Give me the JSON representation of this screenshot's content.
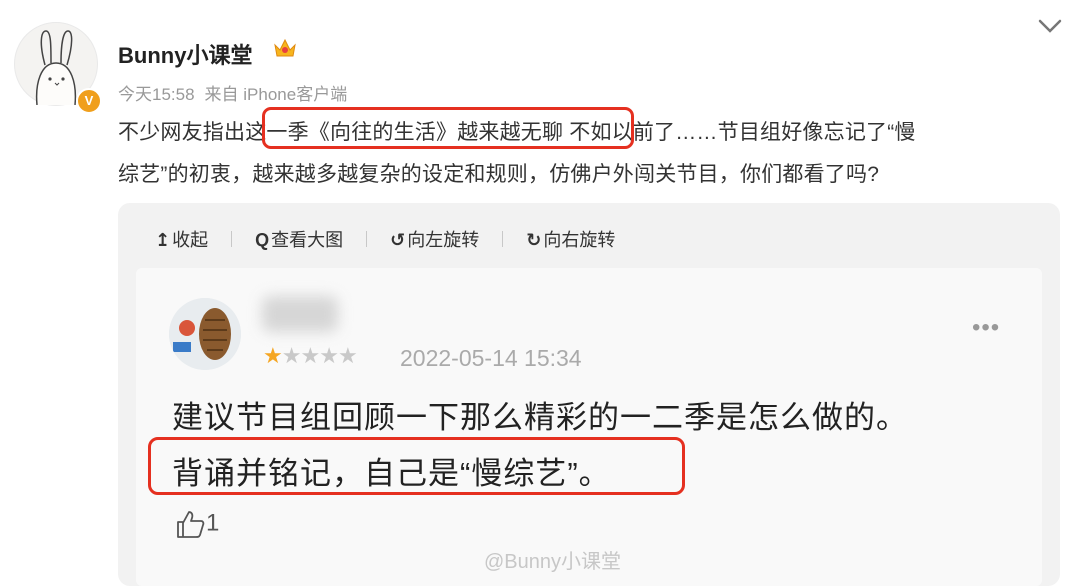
{
  "post": {
    "author": "Bunny小课堂",
    "time": "今天15:58",
    "source": "来自 iPhone客户端",
    "text_line1_a": "不少网友指出",
    "text_line1_b": "这一季《向往的生活》越来越无聊",
    "text_line1_c": " 不如以前了……节目组好像忘记了“慢",
    "text_line2": "综艺”的初衷，越来越多越复杂的设定和规则，仿佛户外闯关节目，你们都看了吗?",
    "verified_badge": "V",
    "icons": [
      "chevron-down-icon",
      "crown-icon",
      "verified-icon"
    ]
  },
  "toolbar": {
    "collapse": "收起",
    "view_large": "查看大图",
    "rotate_left": "向左旋转",
    "rotate_right": "向右旋转",
    "collapse_icon": "↥",
    "view_icon": "Q",
    "rotate_left_icon": "↺",
    "rotate_right_icon": "↻"
  },
  "review": {
    "rating": 1,
    "rating_max": 5,
    "date": "2022-05-14 15:34",
    "line1": "建议节目组回顾一下那么精彩的一二季是怎么做的。",
    "line2": "背诵并铭记，自己是“慢综艺”。",
    "likes": "1",
    "more": "•••"
  },
  "watermark": "@Bunny小课堂",
  "colors": {
    "highlight": "#e53020",
    "star": "#f5a623",
    "badge": "#f09f1c"
  }
}
